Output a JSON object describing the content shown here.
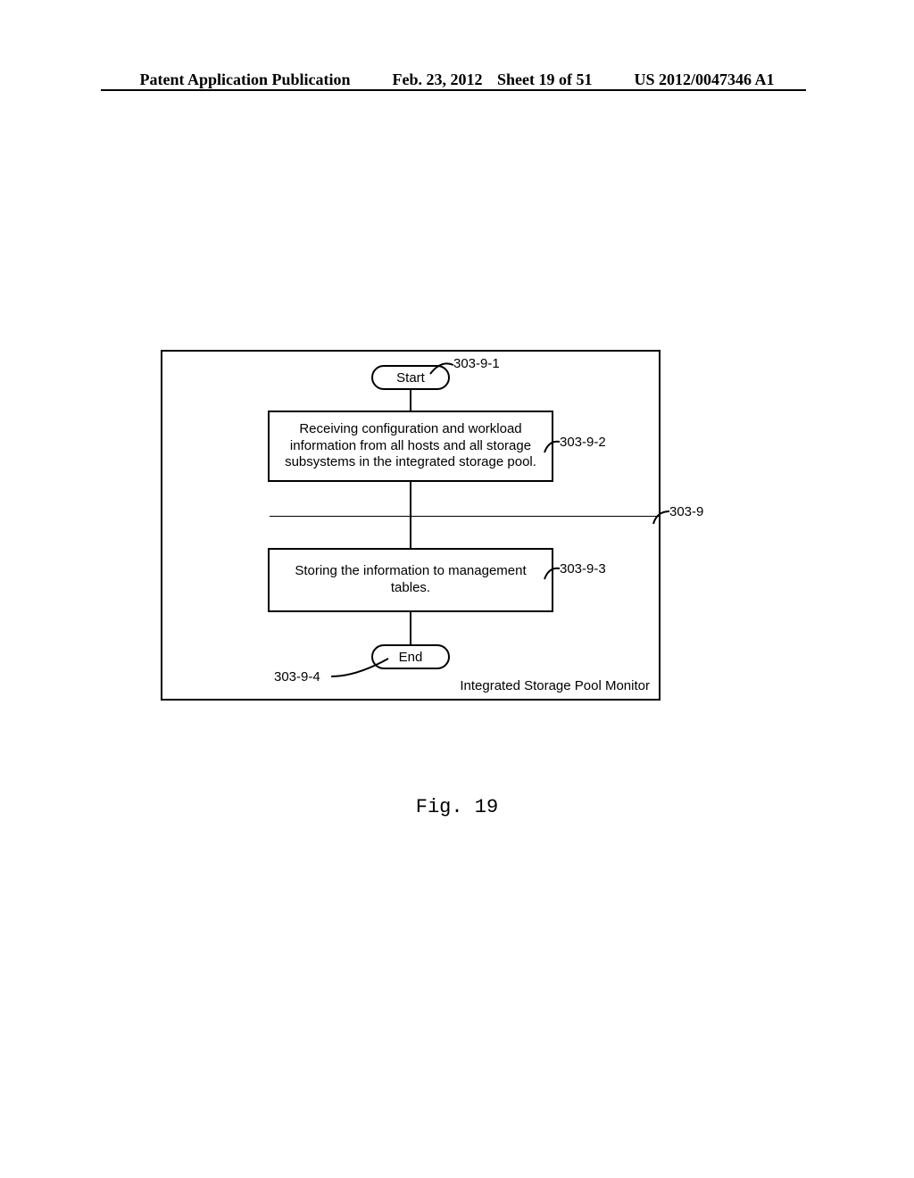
{
  "header": {
    "left": "Patent Application Publication",
    "mid_date": "Feb. 23, 2012",
    "mid_sheet": "Sheet 19 of 51",
    "right": "US 2012/0047346 A1"
  },
  "diagram": {
    "start": "Start",
    "end": "End",
    "step1": "Receiving configuration and workload information from all hosts and all storage subsystems in the integrated storage pool.",
    "step2": "Storing the information to management tables.",
    "footer": "Integrated Storage Pool Monitor"
  },
  "labels": {
    "outer": "303-9",
    "start": "303-9-1",
    "step1": "303-9-2",
    "step2": "303-9-3",
    "end": "303-9-4"
  },
  "figure_caption": "Fig. 19"
}
